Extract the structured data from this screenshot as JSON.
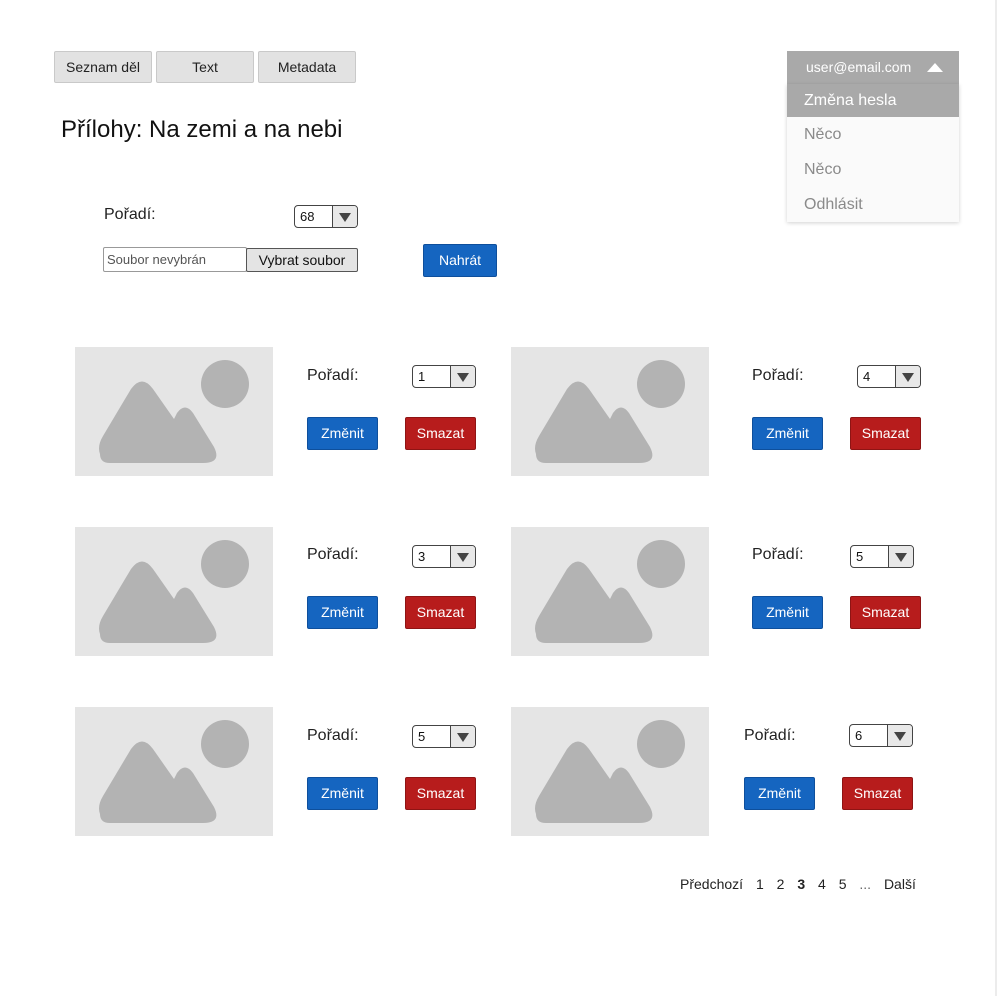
{
  "tabs": [
    {
      "label": "Seznam děl"
    },
    {
      "label": "Text"
    },
    {
      "label": "Metadata"
    }
  ],
  "user_menu": {
    "email": "user@email.com",
    "items": [
      "Změna hesla",
      "Něco",
      "Něco",
      "Odhlásit"
    ],
    "active_index": 0
  },
  "page_title": "Přílohy: Na zemi a na nebi",
  "upload": {
    "order_label": "Pořadí:",
    "order_value": "68",
    "file_placeholder": "Soubor nevybrán",
    "choose_file_label": "Vybrat soubor",
    "upload_label": "Nahrát"
  },
  "attachments": [
    {
      "order_label": "Pořadí:",
      "order_value": "1",
      "change_label": "Změnit",
      "delete_label": "Smazat",
      "image_icon": "image-placeholder-icon"
    },
    {
      "order_label": "Pořadí:",
      "order_value": "4",
      "change_label": "Změnit",
      "delete_label": "Smazat",
      "image_icon": "image-placeholder-icon"
    },
    {
      "order_label": "Pořadí:",
      "order_value": "3",
      "change_label": "Změnit",
      "delete_label": "Smazat",
      "image_icon": "image-placeholder-icon"
    },
    {
      "order_label": "Pořadí:",
      "order_value": "5",
      "change_label": "Změnit",
      "delete_label": "Smazat",
      "image_icon": "image-placeholder-icon"
    },
    {
      "order_label": "Pořadí:",
      "order_value": "5",
      "change_label": "Změnit",
      "delete_label": "Smazat",
      "image_icon": "image-placeholder-icon"
    },
    {
      "order_label": "Pořadí:",
      "order_value": "6",
      "change_label": "Změnit",
      "delete_label": "Smazat",
      "image_icon": "image-placeholder-icon"
    }
  ],
  "pagination": {
    "prev_label": "Předchozí",
    "pages": [
      "1",
      "2",
      "3",
      "4",
      "5"
    ],
    "current_page": "3",
    "ellipsis": "...",
    "next_label": "Další"
  },
  "colors": {
    "primary_button": "#1565c0",
    "danger_button": "#b71c1c",
    "menu_header": "#a9a9a9",
    "thumbnail_bg": "#e5e5e5",
    "thumbnail_icon": "#b3b3b3"
  }
}
